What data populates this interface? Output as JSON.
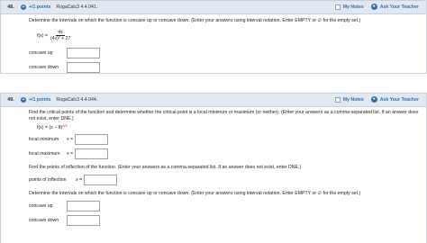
{
  "q48": {
    "number": "48.",
    "points": "+/1 points",
    "source": "RogaCalc3 4.4.041.",
    "my_notes": "My Notes",
    "ask_teacher": "Ask Your Teacher",
    "instruction": "Determine the intervals on which the function is concave up or concave down. (Enter your answers using interval notation. Enter EMPTY or ∅ for the empty set.)",
    "func_lhs": "f(x) =",
    "func_num": "4x",
    "func_den": "(4x)² + 27",
    "concave_up_label": "concave up",
    "concave_down_label": "concave down"
  },
  "q49": {
    "number": "49.",
    "points": "+/1 points",
    "source": "RogaCalc3 4.4.044.",
    "my_notes": "My Notes",
    "ask_teacher": "Ask Your Teacher",
    "instruction1": "Find the critical points of the function and determine whether the critical point is a local minimum or maximum (or neither). (Enter your answers as a comma-separated list. If an answer does not exist, enter DNE.)",
    "func": "f(x) = (x − 8)",
    "func_exp": "2/3",
    "local_min_label": "local minimum",
    "local_max_label": "local maximum",
    "x_eq": "x =",
    "instruction2": "Find the points of inflection of the function. (Enter your answers as a comma-separated list. If an answer does not exist, enter DNE.)",
    "inflection_label": "points of inflection",
    "instruction3": "Determine the intervals on which the function is concave up or concave down. (Enter your answers using interval notation. Enter EMPTY or ∅ for the empty set.)",
    "concave_up_label": "concave up",
    "concave_down_label": "concave down"
  },
  "colors": {
    "header_bg": "#e2e8f1",
    "link": "#2f6fb3",
    "border": "#c9cfd8"
  },
  "icons": {
    "points": "plus-circle-icon",
    "notes": "checkbox-icon",
    "ask": "teacher-icon"
  }
}
